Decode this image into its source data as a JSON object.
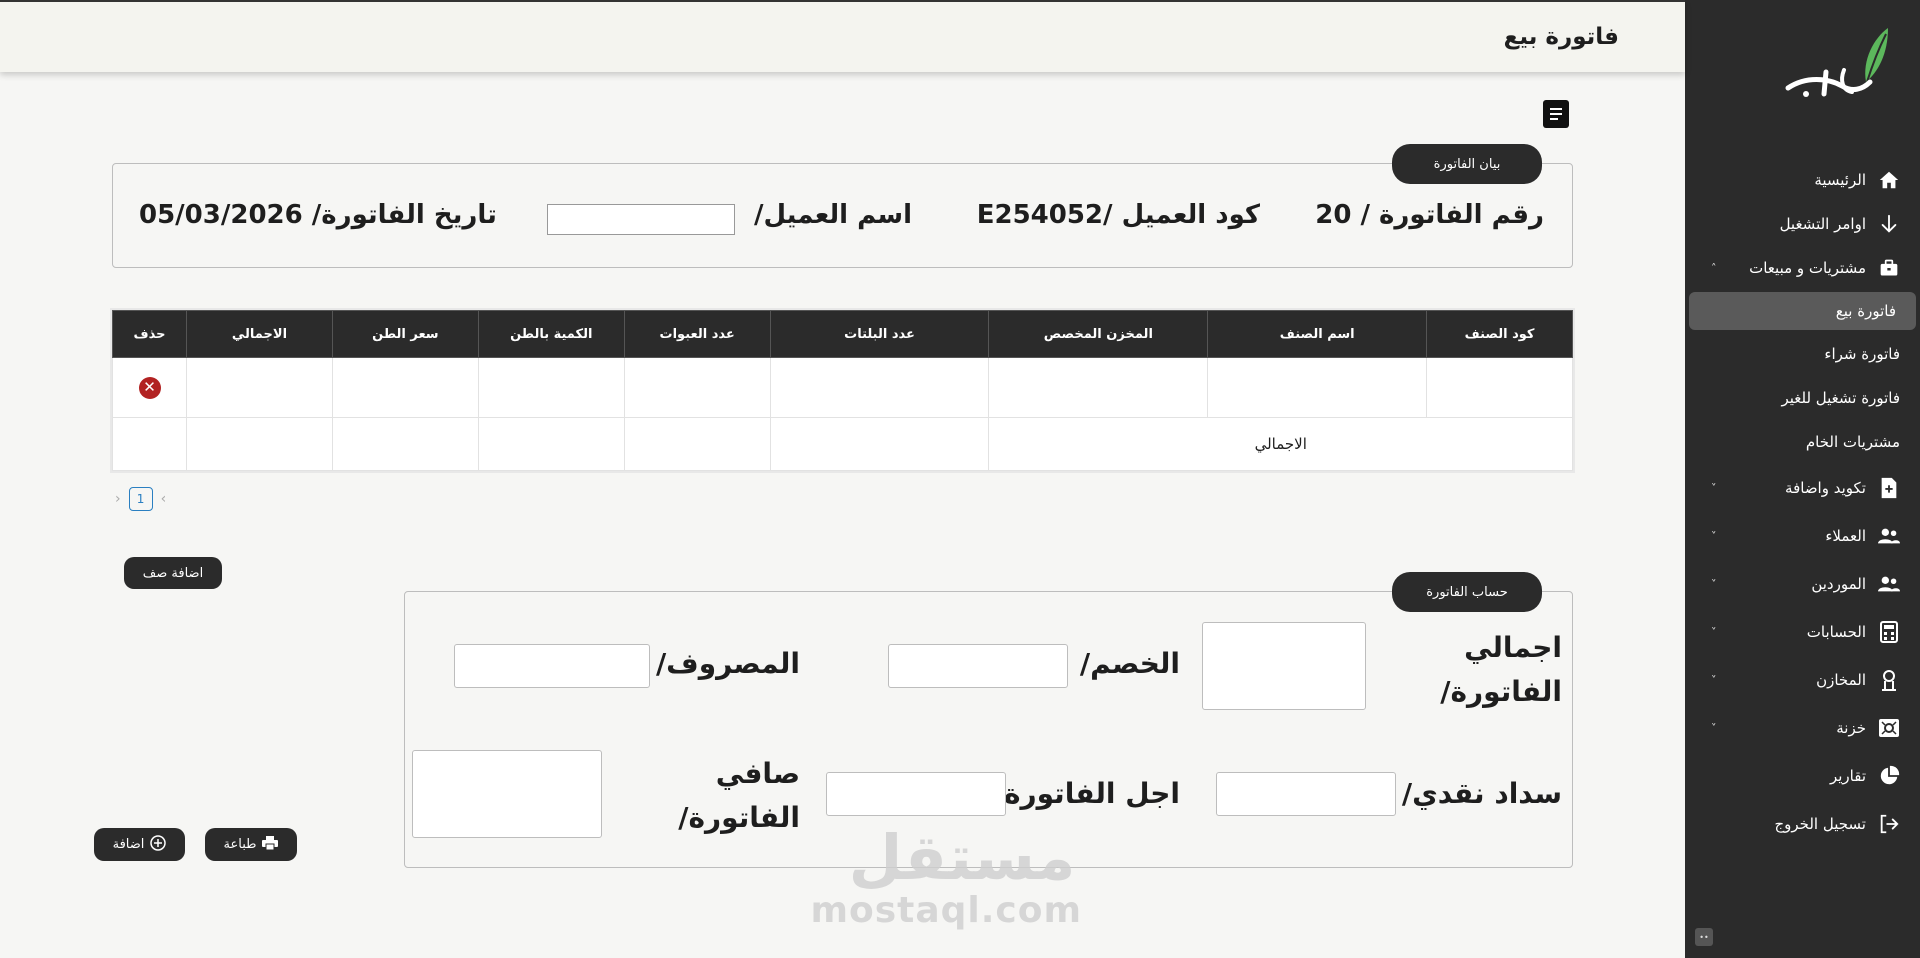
{
  "page": {
    "title": "فاتورة بيع"
  },
  "sidebar": {
    "items": [
      {
        "label": "الرئيسية",
        "icon": "home-icon"
      },
      {
        "label": "اوامر التشغيل",
        "icon": "arrow-down-icon"
      },
      {
        "label": "مشتريات و مبيعات",
        "icon": "briefcase-icon",
        "expanded": true
      }
    ],
    "sub_items": [
      {
        "label": "فاتورة بيع",
        "active": true
      },
      {
        "label": "فاتورة شراء"
      },
      {
        "label": "فاتورة تشغيل للغير"
      },
      {
        "label": "مشتريات الخام"
      }
    ],
    "items_after": [
      {
        "label": "تكويد واضافة",
        "icon": "file-plus-icon"
      },
      {
        "label": "العملاء",
        "icon": "users-icon"
      },
      {
        "label": "الموردين",
        "icon": "users-icon"
      },
      {
        "label": "الحسابات",
        "icon": "calculator-icon"
      },
      {
        "label": "المخازن",
        "icon": "warehouse-icon"
      },
      {
        "label": "خزنة",
        "icon": "safe-icon"
      },
      {
        "label": "تقارير",
        "icon": "pie-chart-icon"
      },
      {
        "label": "تسجيل الخروج",
        "icon": "logout-icon"
      }
    ]
  },
  "invoice_info": {
    "legend": "بيان الفاتورة",
    "invoice_number": "رقم الفاتورة / 20",
    "customer_code": "كود العميل /E254052",
    "customer_name_label": "اسم العميل/",
    "customer_name_value": "",
    "invoice_date": "تاريخ الفاتورة/ 05/03/2026"
  },
  "table": {
    "columns": [
      "كود الصنف",
      "اسم الصنف",
      "المخزن المخصص",
      "عدد البلتات",
      "عدد العبوات",
      "الكمية بالطن",
      "سعر الطن",
      "الاجمالي",
      "حذف"
    ],
    "rows": [
      [
        "",
        "",
        "",
        "",
        "",
        "",
        "",
        "",
        ""
      ]
    ],
    "total_label": "الاجمالي"
  },
  "pager": {
    "current": "1",
    "prev": "‹",
    "next": "›"
  },
  "buttons": {
    "add_row": "اضافة صف",
    "print": "طباعة",
    "add": "اضافة"
  },
  "calc": {
    "legend": "حساب الفاتورة",
    "total_invoice": "اجمالي الفاتورة/",
    "discount": "الخصم/",
    "expense": "المصروف/",
    "cash_payment": "سداد نقدي/",
    "deferred": "اجل الفاتورة/",
    "net_invoice": "صافي الفاتورة/"
  },
  "watermark": {
    "ar": "مستقل",
    "en": "mostaql.com"
  },
  "colors": {
    "sidebar_bg": "#2b2b2b",
    "accent_green": "#4caf50",
    "delete_red": "#b22222"
  }
}
